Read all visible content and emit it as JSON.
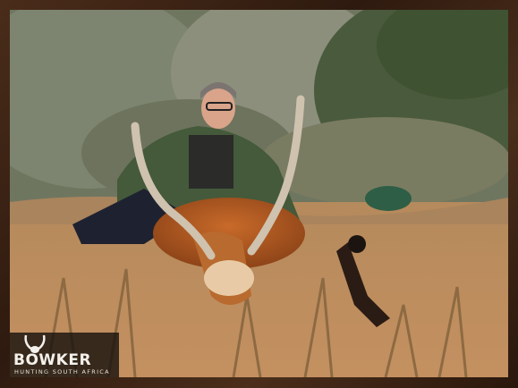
{
  "photo": {
    "subject": "",
    "colors": {
      "frame": "#3a2416",
      "logo_bg": "#19120e",
      "logo_text": "#f4f1ec"
    }
  },
  "logo": {
    "brand": "BOWKER",
    "tagline": "HUNTING SOUTH AFRICA",
    "icon": "antelope-horns-icon"
  }
}
